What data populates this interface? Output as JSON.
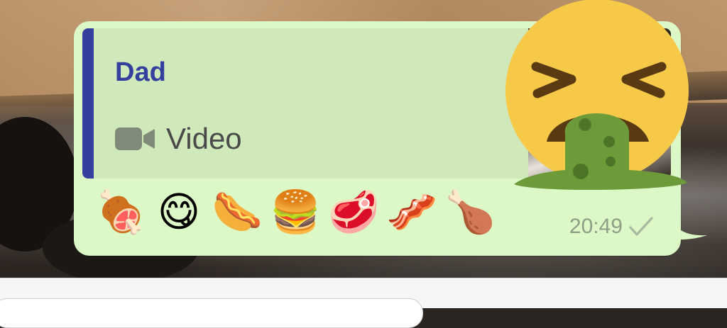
{
  "message": {
    "quote": {
      "sender": "Dad",
      "media_icon": "video-camera-icon",
      "media_label": "Video"
    },
    "emojis": [
      {
        "char": "🍖",
        "name": "meat-on-bone-emoji"
      },
      {
        "char": "😋",
        "name": "yummy-face-emoji"
      },
      {
        "char": "🌭",
        "name": "hot-dog-emoji"
      },
      {
        "char": "🍔",
        "name": "hamburger-emoji"
      },
      {
        "char": "🥩",
        "name": "cut-of-meat-emoji"
      },
      {
        "char": "🥓",
        "name": "bacon-emoji"
      },
      {
        "char": "🍗",
        "name": "poultry-leg-emoji"
      }
    ],
    "time": "20:49",
    "status_icon": "single-check-icon"
  },
  "sticker": {
    "icon": "face-vomiting-emoji-sticker"
  },
  "colors": {
    "bubble": "#dcf8c6",
    "quote_background": "#cfe9bb",
    "quote_accent": "#35409e",
    "time_text": "#8e9e86",
    "sticker_face": "#f7c948",
    "sticker_vomit": "#6e9b3a"
  }
}
